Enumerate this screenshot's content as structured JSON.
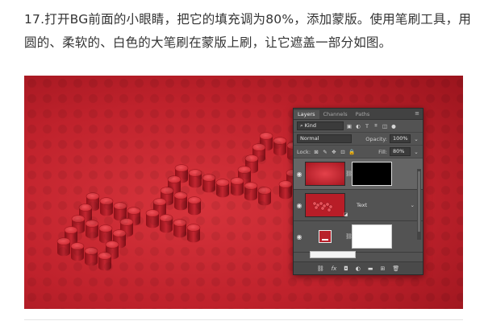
{
  "instruction": {
    "text": "17.打开BG前面的小眼睛，把它的填充调为80%，添加蒙版。使用笔刷工具，用圆的、柔软的、白色的大笔刷在蒙版上刷，让它遮盖一部分如图。"
  },
  "ps_panel": {
    "tabs": [
      "Layers",
      "Channels",
      "Paths"
    ],
    "tab_menu_icon": "panel-menu-icon",
    "filter": {
      "label": "Kind",
      "icons": [
        "image-filter-icon",
        "adjustment-filter-icon",
        "type-filter-icon",
        "shape-filter-icon",
        "smart-object-filter-icon",
        "filter-toggle-icon"
      ]
    },
    "blend_mode": "Normal",
    "opacity": {
      "label": "Opacity:",
      "value": "100%"
    },
    "lock": {
      "label": "Lock:",
      "icons": [
        "lock-transparent-icon",
        "lock-image-icon",
        "lock-position-icon",
        "lock-artboard-icon",
        "lock-all-icon"
      ]
    },
    "fill": {
      "label": "Fill:",
      "value": "80%"
    },
    "layers": [
      {
        "name": "",
        "thumb": "red-gradient",
        "has_mask": true,
        "mask": "black"
      },
      {
        "name": "Text",
        "thumb": "text-3d",
        "has_mask": false,
        "smart_badge": true
      },
      {
        "name": "",
        "thumb": "swatch-icon",
        "has_mask": true,
        "mask": "white"
      }
    ],
    "footer_icons": [
      "link-layers-icon",
      "fx-icon",
      "add-mask-icon",
      "adjustment-layer-icon",
      "group-folder-icon",
      "new-layer-icon",
      "trash-icon"
    ],
    "footer_glyphs": [
      "⛓",
      "fx",
      "◘",
      "◐",
      "▬",
      "⊞",
      "🗑"
    ]
  },
  "colors": {
    "accent": "#c8232d",
    "panel_bg": "#535353",
    "text": "#333333"
  }
}
